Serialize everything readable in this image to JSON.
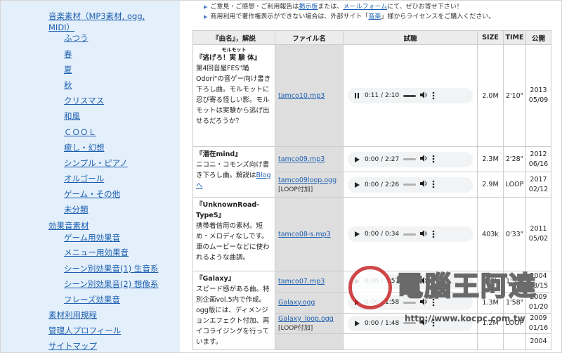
{
  "sidebar": {
    "items": [
      {
        "label": "音楽素材（MP3素材, ogg,",
        "level": 1
      },
      {
        "label": "MIDI）",
        "level": 1
      },
      {
        "label": "ふつう",
        "level": 2
      },
      {
        "label": "春",
        "level": 2
      },
      {
        "label": "夏",
        "level": 2
      },
      {
        "label": "秋",
        "level": 2
      },
      {
        "label": "クリスマス",
        "level": 2
      },
      {
        "label": "和風",
        "level": 2
      },
      {
        "label": "ＣＯＯＬ",
        "level": 2
      },
      {
        "label": "癒し・幻想",
        "level": 2
      },
      {
        "label": "シンプル・ピアノ",
        "level": 2
      },
      {
        "label": "オルゴール",
        "level": 2
      },
      {
        "label": "ゲーム・その他",
        "level": 2
      },
      {
        "label": "未分類",
        "level": 2
      },
      {
        "label": "効果音素材",
        "level": 1
      },
      {
        "label": "ゲーム用効果音",
        "level": 2
      },
      {
        "label": "メニュー用効果音",
        "level": 2
      },
      {
        "label": "シーン別効果音(1) 生音系",
        "level": 2
      },
      {
        "label": "シーン別効果音(2) 想像系",
        "level": 2
      },
      {
        "label": "フレーズ効果音",
        "level": 2
      },
      {
        "label": "素材利用規程",
        "level": 1
      },
      {
        "label": "管理人プロフィール",
        "level": 1
      },
      {
        "label": "サイトマップ",
        "level": 1
      }
    ]
  },
  "notices": [
    {
      "pre": "ご意見・ご感想・ご利用報告は",
      "link": "掲示板",
      "post": "または、",
      "link2": "メールフォーム",
      "post2": "にて、ぜひお寄せ下さい！"
    },
    {
      "pre": "商用利用で著作権表示ができない場合は、外部サイト「",
      "link": "音楽",
      "post": "」様からライセンスをご購入ください。",
      "link2": "",
      "post2": ""
    }
  ],
  "table": {
    "headers": {
      "title": "『曲名』，解説",
      "file": "ファイル名",
      "listen": "試聴",
      "size": "SIZE",
      "time": "TIME",
      "date": "公開"
    },
    "songs": [
      {
        "ruby": "モルモット",
        "title": "『逃げろ！実 験 体』",
        "desc": "第4回音屋FES\"踊Odori\"の音ゲー向け書き下ろし曲。モルモットに忍び寄る怪しい影。モルモットは実験から逃げ出せるだろうか？",
        "files": [
          {
            "name": "tamco10.mp3",
            "loop": "",
            "player_time": "0:11 / 2:10",
            "playing": true,
            "size": "2.0M",
            "time": "2'10\"",
            "date1": "2013",
            "date2": "05/09"
          }
        ]
      },
      {
        "ruby": "",
        "title": "『潜在mind』",
        "desc": "ニコニ・コモンズ向け書き下ろし曲。解説は",
        "desc_link": "Blogへ",
        "files": [
          {
            "name": "tamco09.mp3",
            "loop": "",
            "player_time": "0:00 / 2:27",
            "playing": false,
            "size": "2.3M",
            "time": "2'28\"",
            "date1": "2012",
            "date2": "06/16"
          },
          {
            "name": "tamco09loop.ogg",
            "loop": "[LOOP付加]",
            "player_time": "0:00 / 2:26",
            "playing": false,
            "size": "2.9M",
            "time": "LOOP",
            "date1": "2017",
            "date2": "02/12"
          }
        ]
      },
      {
        "ruby": "",
        "title": "『UnknownRoad-TypeS』",
        "desc": "携帯着信用の素材。短め・メロディなしです。車のムービーなどに使われるような曲調。",
        "files": [
          {
            "name": "tamco08-s.mp3",
            "loop": "",
            "player_time": "0:00 / 0:34",
            "playing": false,
            "size": "403k",
            "time": "0'33\"",
            "date1": "2011",
            "date2": "05/02"
          }
        ]
      },
      {
        "ruby": "",
        "title": "『Galaxy』",
        "desc": "スピード感がある曲。特別企画vol.5内で作成。ogg版には、ディメンジョンエフェクト付加、再イコライジングを行っています。",
        "files": [
          {
            "name": "tamco07.mp3",
            "loop": "",
            "player_time": "0:00 / 1:57",
            "playing": false,
            "size": "805k",
            "time": "1'57\"",
            "date1": "2004",
            "date2": "08/15"
          },
          {
            "name": "Galaxy.ogg",
            "loop": "",
            "player_time": "0:00 / 1:58",
            "playing": false,
            "size": "1.3M",
            "time": "1'58\"",
            "date1": "2009",
            "date2": "01/20"
          },
          {
            "name": "Galaxy_loop.ogg",
            "loop": "[LOOP付加]",
            "player_time": "0:00 / 1:48",
            "playing": false,
            "size": "1.2M",
            "time": "LOOP",
            "date1": "2009",
            "date2": "01/16"
          },
          {
            "name": "",
            "loop": "",
            "player_time": "",
            "playing": false,
            "size": "",
            "time": "",
            "date1": "2004",
            "date2": ""
          }
        ]
      }
    ]
  },
  "watermark": {
    "text": "電腦王阿達",
    "url": "http://www.kocpc.com.tw"
  }
}
